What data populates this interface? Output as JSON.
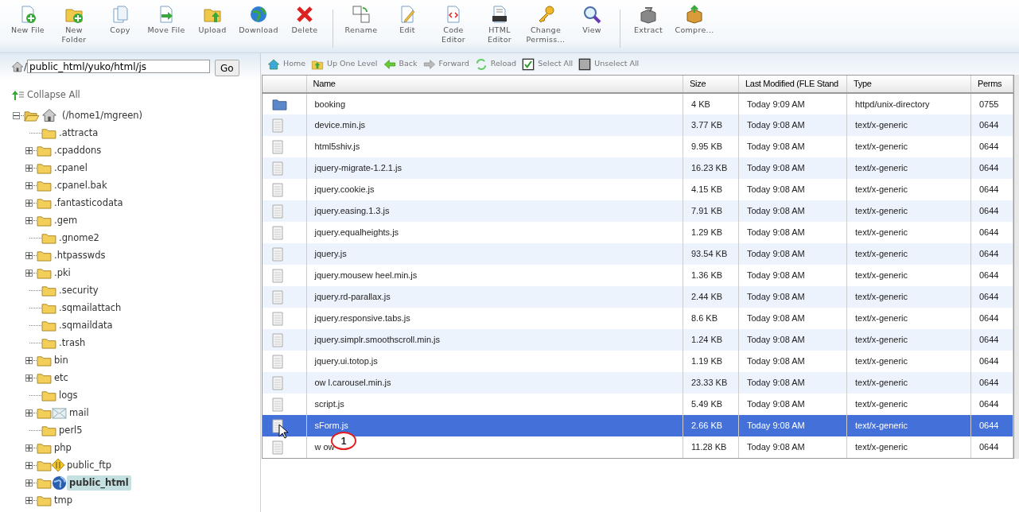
{
  "toolbar_groups": [
    [
      {
        "kind": "new-file",
        "lines": [
          "New File"
        ]
      },
      {
        "kind": "new-folder",
        "lines": [
          "New",
          "Folder"
        ]
      },
      {
        "kind": "copy",
        "lines": [
          "Copy"
        ]
      },
      {
        "kind": "move",
        "lines": [
          "Move File"
        ]
      },
      {
        "kind": "upload",
        "lines": [
          "Upload"
        ]
      },
      {
        "kind": "download",
        "lines": [
          "Download"
        ]
      },
      {
        "kind": "delete",
        "lines": [
          "Delete"
        ]
      }
    ],
    [
      {
        "kind": "rename",
        "lines": [
          "Rename"
        ]
      },
      {
        "kind": "edit",
        "lines": [
          "Edit"
        ]
      },
      {
        "kind": "code",
        "lines": [
          "Code",
          "Editor"
        ]
      },
      {
        "kind": "html",
        "lines": [
          "HTML",
          "Editor"
        ]
      },
      {
        "kind": "perms",
        "lines": [
          "Change",
          "Permiss..."
        ]
      },
      {
        "kind": "view",
        "lines": [
          "View"
        ]
      }
    ],
    [
      {
        "kind": "extract",
        "lines": [
          "Extract"
        ]
      },
      {
        "kind": "compress",
        "lines": [
          "Compre..."
        ]
      }
    ]
  ],
  "path": {
    "value": "public_html/yuko/html/js",
    "separator": "/",
    "button": "Go"
  },
  "collapse_all": "Collapse All",
  "tree": {
    "label": "(/home1/mgreen)",
    "expanded": true,
    "selected": false,
    "children": [
      {
        "label": ".attracta",
        "expandable": false,
        "selected": false
      },
      {
        "label": ".cpaddons",
        "expandable": true,
        "selected": false
      },
      {
        "label": ".cpanel",
        "expandable": true,
        "selected": false
      },
      {
        "label": ".cpanel.bak",
        "expandable": true,
        "selected": false
      },
      {
        "label": ".fantasticodata",
        "expandable": true,
        "selected": false
      },
      {
        "label": ".gem",
        "expandable": true,
        "selected": false
      },
      {
        "label": ".gnome2",
        "expandable": false,
        "selected": false
      },
      {
        "label": ".htpasswds",
        "expandable": true,
        "selected": false
      },
      {
        "label": ".pki",
        "expandable": true,
        "selected": false
      },
      {
        "label": ".security",
        "expandable": false,
        "selected": false
      },
      {
        "label": ".sqmailattach",
        "expandable": false,
        "selected": false
      },
      {
        "label": ".sqmaildata",
        "expandable": false,
        "selected": false
      },
      {
        "label": ".trash",
        "expandable": false,
        "selected": false
      },
      {
        "label": "bin",
        "expandable": true,
        "selected": false
      },
      {
        "label": "etc",
        "expandable": true,
        "selected": false
      },
      {
        "label": "logs",
        "expandable": false,
        "selected": false
      },
      {
        "label": "mail",
        "expandable": true,
        "selected": false,
        "kind": "mail"
      },
      {
        "label": "perl5",
        "expandable": false,
        "selected": false
      },
      {
        "label": "php",
        "expandable": true,
        "selected": false
      },
      {
        "label": "public_ftp",
        "expandable": true,
        "selected": false,
        "kind": "ftp"
      },
      {
        "label": "public_html",
        "expandable": true,
        "selected": true,
        "kind": "web"
      },
      {
        "label": "tmp",
        "expandable": true,
        "selected": false
      }
    ]
  },
  "nav": [
    {
      "kind": "home",
      "label": "Home"
    },
    {
      "kind": "up",
      "label": "Up One Level"
    },
    {
      "kind": "back",
      "label": "Back"
    },
    {
      "kind": "forward",
      "label": "Forward"
    },
    {
      "kind": "reload",
      "label": "Reload"
    },
    {
      "kind": "select-all",
      "label": "Select All"
    },
    {
      "kind": "unselect-all",
      "label": "Unselect All"
    }
  ],
  "table": {
    "columns": [
      "Name",
      "Size",
      "Last Modified (FLE Stand",
      "Type",
      "Perms"
    ],
    "rows": [
      {
        "kind": "folder",
        "name": "booking",
        "size": "4 KB",
        "modified": "Today 9:09 AM",
        "type": "httpd/unix-directory",
        "perms": "0755",
        "selected": false
      },
      {
        "kind": "file",
        "name": "device.min.js",
        "size": "3.77 KB",
        "modified": "Today 9:08 AM",
        "type": "text/x-generic",
        "perms": "0644",
        "selected": false
      },
      {
        "kind": "file",
        "name": "html5shiv.js",
        "size": "9.95 KB",
        "modified": "Today 9:08 AM",
        "type": "text/x-generic",
        "perms": "0644",
        "selected": false
      },
      {
        "kind": "file",
        "name": "jquery-migrate-1.2.1.js",
        "size": "16.23 KB",
        "modified": "Today 9:08 AM",
        "type": "text/x-generic",
        "perms": "0644",
        "selected": false
      },
      {
        "kind": "file",
        "name": "jquery.cookie.js",
        "size": "4.15 KB",
        "modified": "Today 9:08 AM",
        "type": "text/x-generic",
        "perms": "0644",
        "selected": false
      },
      {
        "kind": "file",
        "name": "jquery.easing.1.3.js",
        "size": "7.91 KB",
        "modified": "Today 9:08 AM",
        "type": "text/x-generic",
        "perms": "0644",
        "selected": false
      },
      {
        "kind": "file",
        "name": "jquery.equalheights.js",
        "size": "1.29 KB",
        "modified": "Today 9:08 AM",
        "type": "text/x-generic",
        "perms": "0644",
        "selected": false
      },
      {
        "kind": "file",
        "name": "jquery.js",
        "size": "93.54 KB",
        "modified": "Today 9:08 AM",
        "type": "text/x-generic",
        "perms": "0644",
        "selected": false
      },
      {
        "kind": "file",
        "name": "jquery.mousew heel.min.js",
        "size": "1.36 KB",
        "modified": "Today 9:08 AM",
        "type": "text/x-generic",
        "perms": "0644",
        "selected": false
      },
      {
        "kind": "file",
        "name": "jquery.rd-parallax.js",
        "size": "2.44 KB",
        "modified": "Today 9:08 AM",
        "type": "text/x-generic",
        "perms": "0644",
        "selected": false
      },
      {
        "kind": "file",
        "name": "jquery.responsive.tabs.js",
        "size": "8.6 KB",
        "modified": "Today 9:08 AM",
        "type": "text/x-generic",
        "perms": "0644",
        "selected": false
      },
      {
        "kind": "file",
        "name": "jquery.simplr.smoothscroll.min.js",
        "size": "1.24 KB",
        "modified": "Today 9:08 AM",
        "type": "text/x-generic",
        "perms": "0644",
        "selected": false
      },
      {
        "kind": "file",
        "name": "jquery.ui.totop.js",
        "size": "1.19 KB",
        "modified": "Today 9:08 AM",
        "type": "text/x-generic",
        "perms": "0644",
        "selected": false
      },
      {
        "kind": "file",
        "name": "ow l.carousel.min.js",
        "size": "23.33 KB",
        "modified": "Today 9:08 AM",
        "type": "text/x-generic",
        "perms": "0644",
        "selected": false
      },
      {
        "kind": "file",
        "name": "script.js",
        "size": "5.49 KB",
        "modified": "Today 9:08 AM",
        "type": "text/x-generic",
        "perms": "0644",
        "selected": false
      },
      {
        "kind": "file",
        "name": "sForm.js",
        "size": "2.66 KB",
        "modified": "Today 9:08 AM",
        "type": "text/x-generic",
        "perms": "0644",
        "selected": true
      },
      {
        "kind": "file",
        "name": "w ow",
        "size": "11.28 KB",
        "modified": "Today 9:08 AM",
        "type": "text/x-generic",
        "perms": "0644",
        "selected": false
      }
    ]
  },
  "callout": "1"
}
